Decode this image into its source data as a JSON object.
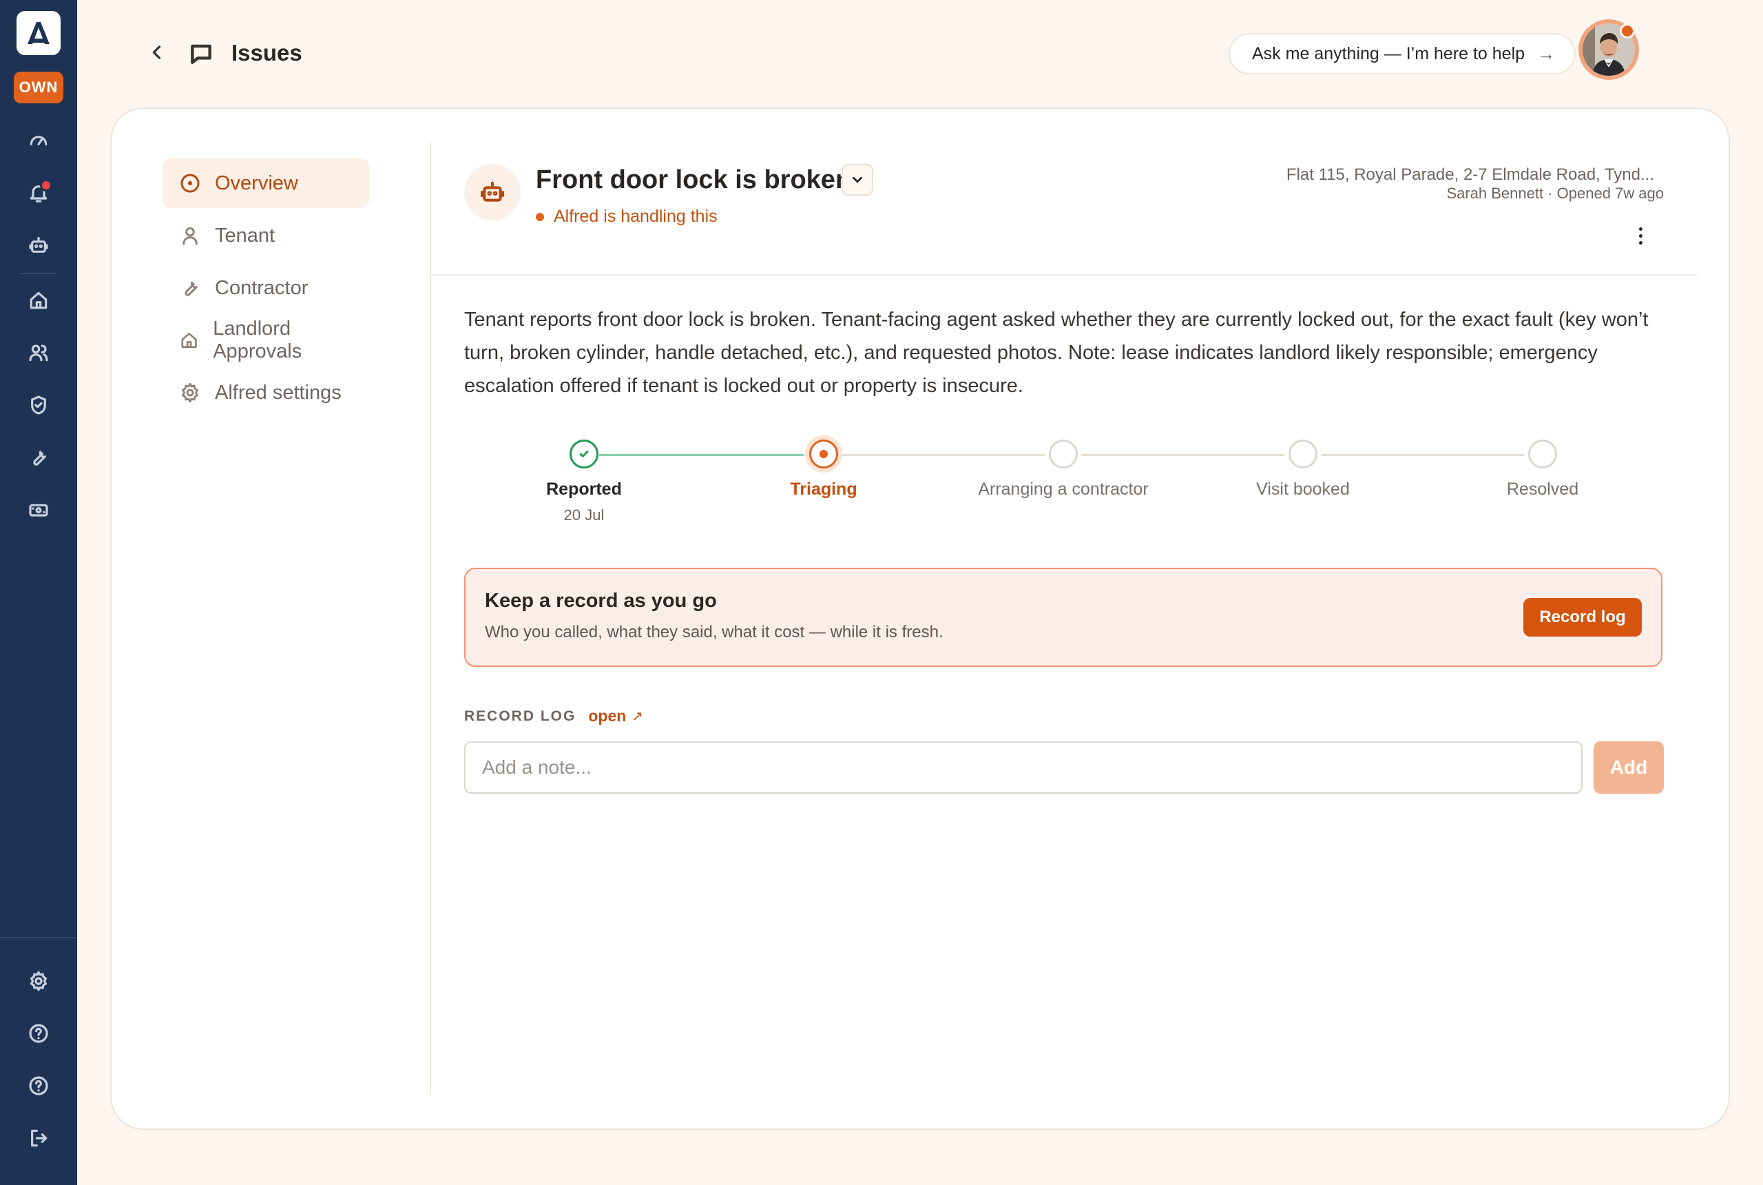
{
  "sidebar": {
    "logo_letter": "A",
    "badge": "OWN",
    "icons": [
      "dashboard-icon",
      "bell-icon",
      "bot-icon",
      "home-icon",
      "users-icon",
      "shield-icon",
      "wrench-icon",
      "money-icon"
    ],
    "bottom_icons": [
      "settings-icon",
      "help-icon",
      "help-icon",
      "logout-icon"
    ]
  },
  "header": {
    "title": "Issues",
    "assistant_prompt": "Ask me anything — I’m here to help",
    "assistant_arrow": "→"
  },
  "subnav": {
    "items": [
      {
        "label": "Overview",
        "icon": "circle-dot-icon",
        "active": true
      },
      {
        "label": "Tenant",
        "icon": "person-icon",
        "active": false
      },
      {
        "label": "Contractor",
        "icon": "wrench-icon",
        "active": false
      },
      {
        "label": "Landlord Approvals",
        "icon": "home-icon",
        "active": false
      },
      {
        "label": "Alfred settings",
        "icon": "gear-icon",
        "active": false
      }
    ]
  },
  "issue": {
    "title": "Front door lock is broken",
    "status": "Alfred is handling this",
    "address": "Flat 115, Royal Parade, 2-7 Elmdale Road, Tynd...",
    "meta": "Sarah Bennett · Opened 7w ago",
    "description": "Tenant reports front door lock is broken. Tenant-facing agent asked whether they are currently locked out, for the exact fault (key won’t turn, broken cylinder, handle detached, etc.), and requested photos. Note: lease indicates landlord likely responsible; emergency escalation offered if tenant is locked out or property is insecure."
  },
  "stepper": {
    "steps": [
      {
        "label": "Reported",
        "state": "done",
        "date": "20 Jul"
      },
      {
        "label": "Triaging",
        "state": "current",
        "date": ""
      },
      {
        "label": "Arranging a contractor",
        "state": "pending",
        "date": ""
      },
      {
        "label": "Visit booked",
        "state": "pending",
        "date": ""
      },
      {
        "label": "Resolved",
        "state": "pending",
        "date": ""
      }
    ]
  },
  "record_box": {
    "title": "Keep a record as you go",
    "subtitle": "Who you called, what they said, what it cost — while it is fresh.",
    "button": "Record log"
  },
  "record_log": {
    "label": "RECORD LOG",
    "open_link": "open",
    "open_arrow": "↗",
    "placeholder": "Add a note...",
    "add_button": "Add"
  },
  "colors": {
    "accent": "#d5540e",
    "rail": "#1e3354",
    "success": "#1f9a53",
    "background": "#fdf6f0"
  }
}
